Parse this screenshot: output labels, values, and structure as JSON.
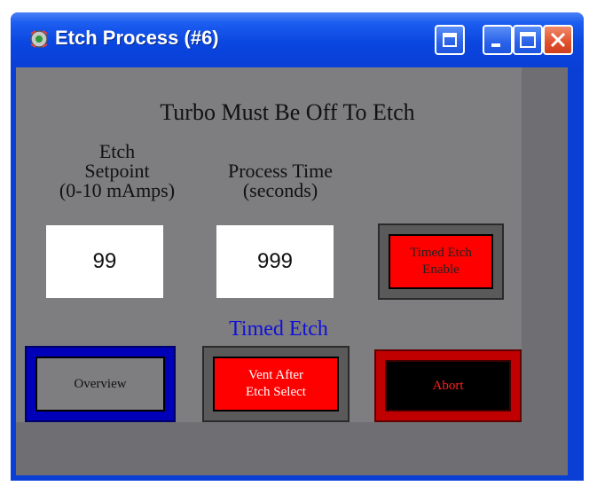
{
  "window": {
    "title": "Etch Process (#6)"
  },
  "panel": {
    "heading": "Turbo Must Be Off To Etch",
    "setpoint": {
      "label_line1": "Etch",
      "label_line2": "Setpoint",
      "label_line3": "(0-10 mAmps)",
      "value": "99"
    },
    "process_time": {
      "label_line1": "Process Time",
      "label_line2": "(seconds)",
      "value": "999"
    },
    "timed_etch_label": "Timed Etch",
    "buttons": {
      "timed_etch_enable_line1": "Timed Etch",
      "timed_etch_enable_line2": "Enable",
      "overview": "Overview",
      "vent_line1": "Vent After",
      "vent_line2": "Etch Select",
      "abort": "Abort"
    }
  },
  "colors": {
    "titlebar": "#0a46e0",
    "panel_bg": "#7e7d80",
    "active_red": "#ff0000",
    "timed_etch_text": "#1010d8",
    "overview_border": "#0000b8",
    "abort_border": "#c00000"
  },
  "icons": {
    "app": "gear-app-icon",
    "restore": "restore-icon",
    "minimize": "minimize-icon",
    "maximize": "maximize-icon",
    "close": "close-icon"
  }
}
